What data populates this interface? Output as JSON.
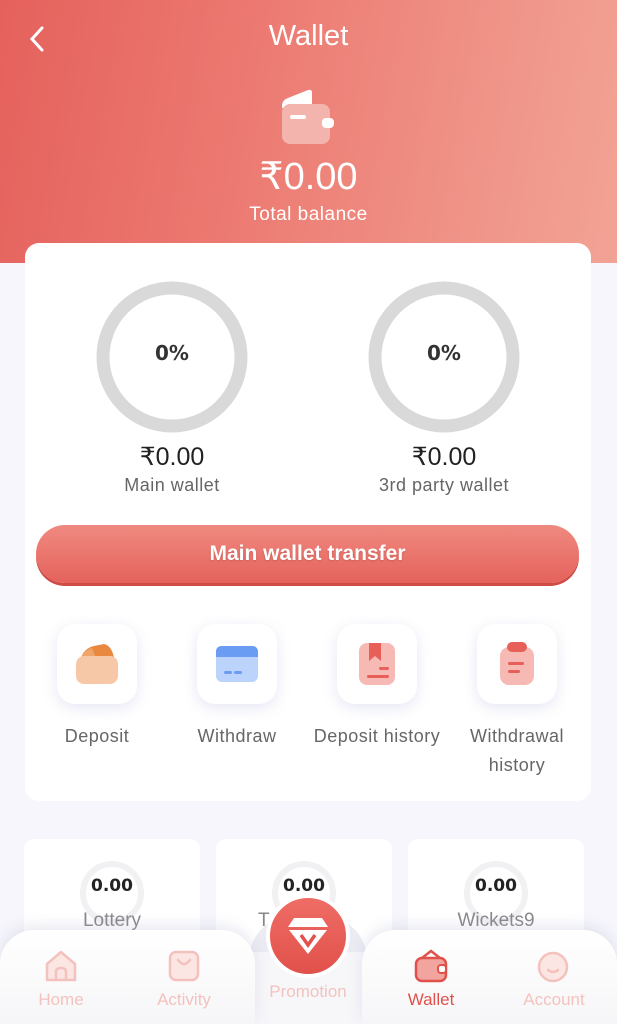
{
  "header": {
    "title": "Wallet",
    "total_amount": "₹0.00",
    "total_label": "Total balance"
  },
  "wallets": [
    {
      "percent": "0%",
      "amount": "₹0.00",
      "label": "Main wallet"
    },
    {
      "percent": "0%",
      "amount": "₹0.00",
      "label": "3rd party wallet"
    }
  ],
  "transfer_button": "Main wallet transfer",
  "actions": [
    {
      "label": "Deposit",
      "icon": "deposit-icon"
    },
    {
      "label": "Withdraw",
      "icon": "withdraw-card-icon"
    },
    {
      "label": "Deposit history",
      "icon": "deposit-history-icon"
    },
    {
      "label": "Withdrawal history",
      "icon": "withdrawal-history-icon"
    }
  ],
  "games": [
    {
      "value": "0.00",
      "name": "Lottery"
    },
    {
      "value": "0.00",
      "name": "T"
    },
    {
      "value": "0.00",
      "name": "Wickets9"
    }
  ],
  "nav": {
    "items": [
      {
        "label": "Home"
      },
      {
        "label": "Activity"
      },
      {
        "label": "Promotion"
      },
      {
        "label": "Wallet"
      },
      {
        "label": "Account"
      }
    ],
    "active": "Wallet"
  },
  "colors": {
    "accent": "#e5615c",
    "nav_inactive": "#f3c2bd",
    "nav_active": "#e0514b"
  }
}
